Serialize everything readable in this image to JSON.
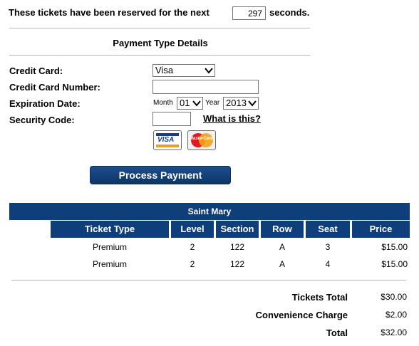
{
  "timer": {
    "prefix": "These tickets have been reserved for the next",
    "value": "297",
    "suffix": "seconds."
  },
  "section_title": "Payment Type Details",
  "form": {
    "credit_card_label": "Credit Card:",
    "credit_card_value": "Visa",
    "card_number_label": "Credit Card Number:",
    "card_number_value": "",
    "expiration_label": "Expiration Date:",
    "month_label": "Month",
    "month_value": "01",
    "year_label": "Year",
    "year_value": "2013",
    "security_label": "Security Code:",
    "security_value": "",
    "what_is_this": "What is this?",
    "visa_logo": "VISA",
    "mastercard_logo": "MasterCard"
  },
  "process_button": "Process Payment",
  "venue": "Saint Mary",
  "table": {
    "headers": [
      "Ticket Type",
      "Level",
      "Section",
      "Row",
      "Seat",
      "Price"
    ],
    "rows": [
      [
        "Premium",
        "2",
        "122",
        "A",
        "3",
        "$15.00"
      ],
      [
        "Premium",
        "2",
        "122",
        "A",
        "4",
        "$15.00"
      ]
    ]
  },
  "totals": {
    "tickets_total_label": "Tickets Total",
    "tickets_total_value": "$30.00",
    "convenience_label": "Convenience Charge",
    "convenience_value": "$2.00",
    "total_label": "Total",
    "total_value": "$32.00"
  },
  "colors": {
    "header_bar": "#0f3f7a",
    "button": "#1c4e8f",
    "divider": "#b4b4b4"
  }
}
